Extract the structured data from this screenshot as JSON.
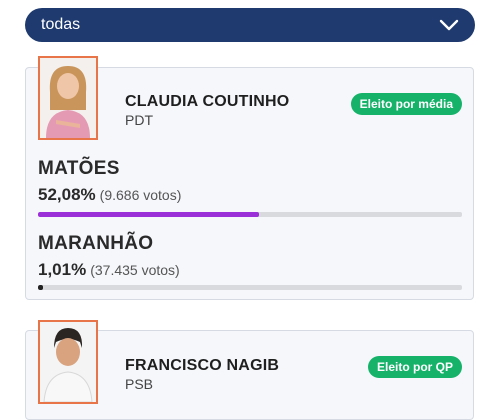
{
  "filter": {
    "selected": "todas"
  },
  "candidates": [
    {
      "name": "CLAUDIA COUTINHO",
      "party": "PDT",
      "status": "Eleito por média",
      "results": [
        {
          "place": "MATÕES",
          "percent": "52,08%",
          "votes": "(9.686 votos)",
          "share": 0.5208,
          "color": "#9b30d9"
        },
        {
          "place": "MARANHÃO",
          "percent": "1,01%",
          "votes": "(37.435 votos)",
          "share": 0.0101,
          "color": "#222222"
        }
      ]
    },
    {
      "name": "FRANCISCO NAGIB",
      "party": "PSB",
      "status": "Eleito por QP"
    }
  ],
  "colors": {
    "filter_bg": "#1e3a6e",
    "badge": "#17b26a",
    "photo_border": "#e8744a"
  }
}
